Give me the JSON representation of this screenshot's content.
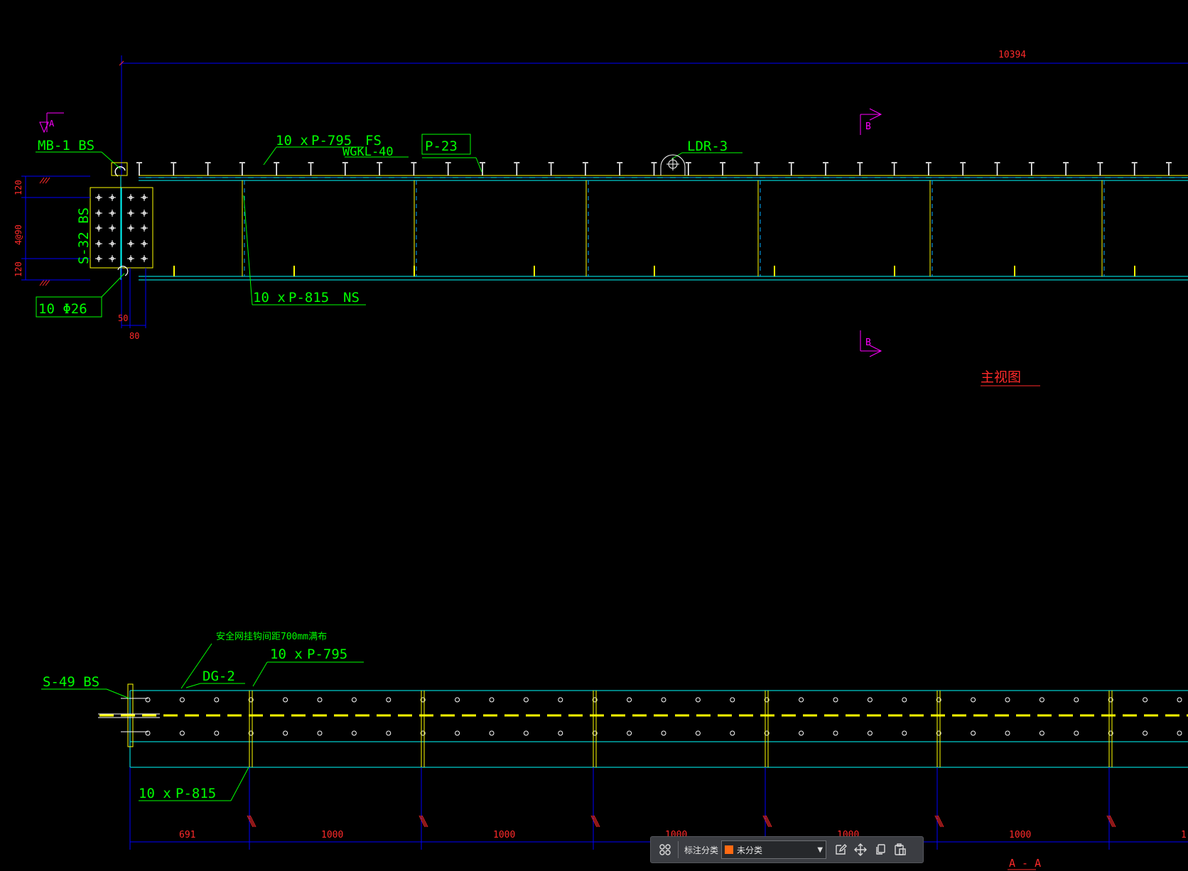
{
  "colors": {
    "background": "#000000",
    "dim_line": "#0000ff",
    "dim_text": "#ff2a2a",
    "label": "#00ff00",
    "section": "#ff00ff",
    "beam": "#00ffff",
    "stud": "#ffff00"
  },
  "top_view": {
    "overall_dim": "10394",
    "callouts": {
      "mb": "MB-1 BS",
      "p795_count": "10 x",
      "p795": "P-795",
      "fs": "FS",
      "wgk": "WGKL-40",
      "p23": "P-23",
      "ldr": "LDR-3",
      "bolt_spec": "S-32 BS",
      "bolt_dia": "10 Φ26",
      "p815_count": "10 x",
      "p815": "P-815",
      "ns": "NS"
    },
    "left_dims": [
      "120",
      "4@90",
      "120"
    ],
    "bottom_dims": [
      "50",
      "80"
    ],
    "section_marks": {
      "a": "A",
      "b_top": "B",
      "b_bottom": "B"
    },
    "view_title": "主视图"
  },
  "bottom_view": {
    "note": "安全网挂钩间距700mm满布",
    "callouts": {
      "p795_count": "10 x",
      "p795": "P-795",
      "dg": "DG-2",
      "s49": "S-49 BS",
      "p815_count": "10 x",
      "p815": "P-815"
    },
    "dims": [
      "691",
      "1000",
      "1000",
      "1000",
      "1000",
      "1000"
    ],
    "dim_last_partial": "1",
    "view_title": "A - A"
  },
  "toolbar": {
    "category_label": "标注分类",
    "category_value": "未分类",
    "swatch_color": "#ff6a13",
    "icons": [
      "grid-icon",
      "edit-icon",
      "move-icon",
      "copy-icon",
      "paste-icon"
    ]
  }
}
